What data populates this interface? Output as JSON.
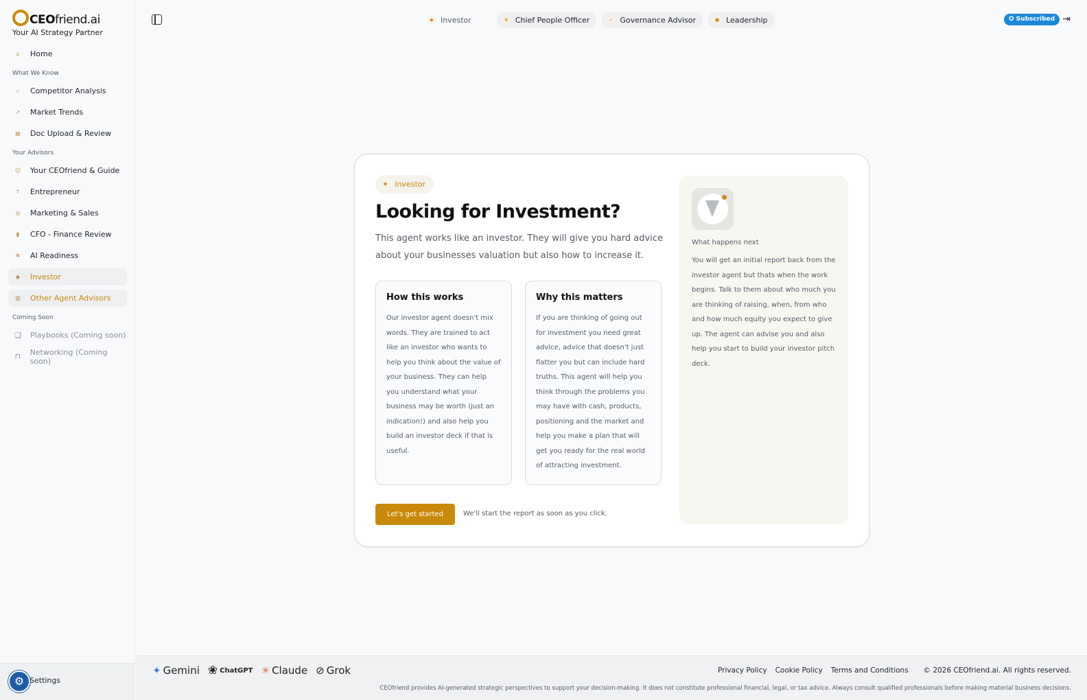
{
  "brand": {
    "name_bold": "CEO",
    "name_rest": "friend.ai",
    "tagline": "Your AI Strategy Partner"
  },
  "sidebar": {
    "home": "Home",
    "section_know": "What We Know",
    "know_items": [
      "Competitor Analysis",
      "Market Trends",
      "Doc Upload & Review"
    ],
    "section_advisors": "Your Advisors",
    "advisor_items": [
      "Your CEOfriend & Guide",
      "Entrepreneur",
      "Marketing & Sales",
      "CFO - Finance Review",
      "AI Readiness",
      "Investor",
      "Other Agent Advisors"
    ],
    "section_soon": "Coming Soon",
    "soon_items": [
      "Playbooks (Coming soon)",
      "Networking (Coming soon)"
    ],
    "settings": "Settings"
  },
  "header": {
    "tabs": [
      "Investor",
      "Chief People Officer",
      "Governance Advisor",
      "Leadership"
    ],
    "subscribed": "✪ Subscribed"
  },
  "card": {
    "badge": "Investor",
    "title": "Looking for Investment?",
    "lead": "This agent works like an investor. They will give you hard advice about your businesses valuation but also how to increase it.",
    "box1_title": "How this works",
    "box1_text": "Our investor agent doesn't mix words. They are trained to act like an investor who wants to help you think about the value of your business. They can help you understand what your business may be worth (just an indication!) and also help you build an investor deck if that is useful.",
    "box2_title": "Why this matters",
    "box2_text": "If you are thinking of going out for investment you need great advice, advice that doesn't just flatter you but can include hard truths. This agent will help you think through the problems you may have with cash, products, positioning and the market and help you make a plan that will get you ready for the real world of attracting investment.",
    "cta": "Let's get started",
    "cta_note": "We'll start the report as soon as you click.",
    "side_title": "What happens next",
    "side_text": "You will get an initial report back from the investor agent but thats when the work begins. Talk to them about who much you are thinking of raising, when, from who and how much equity you expect to give up. The agent can advise you and also help you start to build your investor pitch deck."
  },
  "footer": {
    "ai_brands": [
      "Gemini",
      "ChatGPT",
      "Claude",
      "Grok"
    ],
    "links": [
      "Privacy Policy",
      "Cookie Policy",
      "Terms and Conditions"
    ],
    "copyright": "© 2026 CEOfriend.ai. All rights reserved.",
    "disclaimer": "CEOfriend provides AI-generated strategic perspectives to support your decision-making. It does not constitute professional financial, legal, or tax advice. Always consult qualified professionals before making material business decisions."
  },
  "colors": {
    "accent": "#c98a0b",
    "subscribed_bg": "#1a8ad8",
    "settings_bg": "#1f5aa6"
  },
  "icons": {
    "home": "house-icon",
    "search": "magnifier-icon",
    "trend": "chart-line-icon",
    "doc": "document-icon",
    "book": "book-icon",
    "lock": "lock-icon",
    "sidebar_toggle": "sidebar-toggle-icon",
    "logout": "logout-icon"
  }
}
